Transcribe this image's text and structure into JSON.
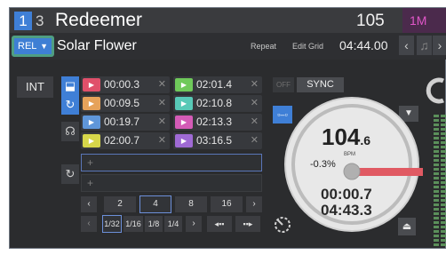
{
  "header": {
    "deck_number": "1",
    "deck_secondary": "3",
    "title": "Redeemer",
    "bpm": "105",
    "key": "1M"
  },
  "row2": {
    "mode_label": "REL",
    "track": "Solar Flower",
    "repeat_label": "Repeat",
    "edit_grid_label": "Edit Grid",
    "time": "04:44.00"
  },
  "controls": {
    "int_label": "INT",
    "off_label": "OFF",
    "sync_label": "SYNC"
  },
  "cues": [
    {
      "time": "00:00.3",
      "color": "#e0506a"
    },
    {
      "time": "02:01.4",
      "color": "#6fc95a"
    },
    {
      "time": "00:09.5",
      "color": "#e6a25a"
    },
    {
      "time": "02:10.8",
      "color": "#58c9b7"
    },
    {
      "time": "00:19.7",
      "color": "#5f96d9"
    },
    {
      "time": "02:13.3",
      "color": "#d45bb6"
    },
    {
      "time": "02:00.7",
      "color": "#d6d64a"
    },
    {
      "time": "03:16.5",
      "color": "#9f6ad4"
    }
  ],
  "loop_rows": [
    "+",
    "+"
  ],
  "beat_sizes": [
    "2",
    "4",
    "8",
    "16"
  ],
  "fractions": [
    "1/32",
    "1/16",
    "1/8",
    "1/4"
  ],
  "platter": {
    "bpm_int": "104",
    "bpm_dec": ".6",
    "bpm_unit": "BPM",
    "pitch_pct": "-0.3%",
    "elapsed": "00:00.7",
    "remaining": "04:43.3"
  },
  "colors": {
    "accent_blue": "#3f7fd6",
    "highlight_green": "#4f9e82",
    "key_pink": "#e056c8",
    "pitch_red": "#e05a63"
  }
}
